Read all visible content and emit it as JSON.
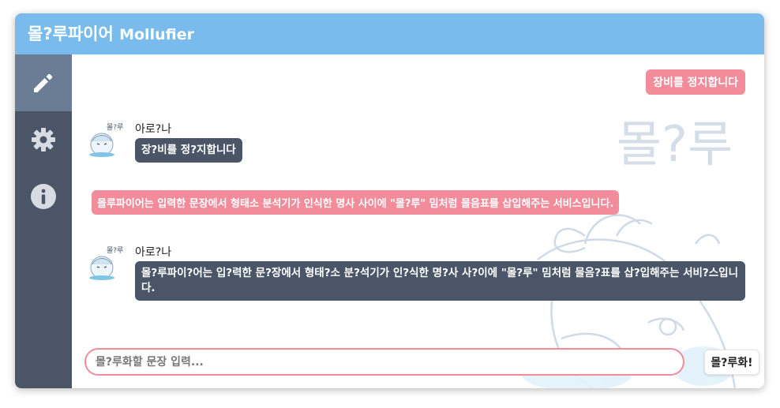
{
  "app": {
    "title_ko": "몰?루파이어",
    "title_en": "Mollufier",
    "header_color": "#7abbee",
    "accent_color": "#f28b9a",
    "dark_color": "#4a5568"
  },
  "sidebar": {
    "items": [
      {
        "icon": "pencil-icon",
        "active": true
      },
      {
        "icon": "gear-icon",
        "active": false
      },
      {
        "icon": "info-icon",
        "active": false
      }
    ]
  },
  "chat": {
    "user_message_1": "장비를 정지합니다",
    "bot_1": {
      "name": "아로?나",
      "text": "장?비를 정?지합니다"
    },
    "user_message_2": "몰루파이어는 입력한 문장에서 형태소 분석기가 인식한 명사 사이에 \"몰?루\" 밈처럼 물음표를 삽입해주는 서비스입니다.",
    "bot_2": {
      "name": "아로?나",
      "text": "몰?루파이?어는 입?력한 문?장에서 형태?소 분?석기가 인?식한 명?사 사?이에 \"몰?루\" 밈처럼 물음?표를 삽?입해주는 서비?스입니다."
    },
    "watermark": "몰?루"
  },
  "composer": {
    "placeholder": "몰?루화할 문장 입력...",
    "value": "",
    "button_label": "몰?루화!"
  }
}
